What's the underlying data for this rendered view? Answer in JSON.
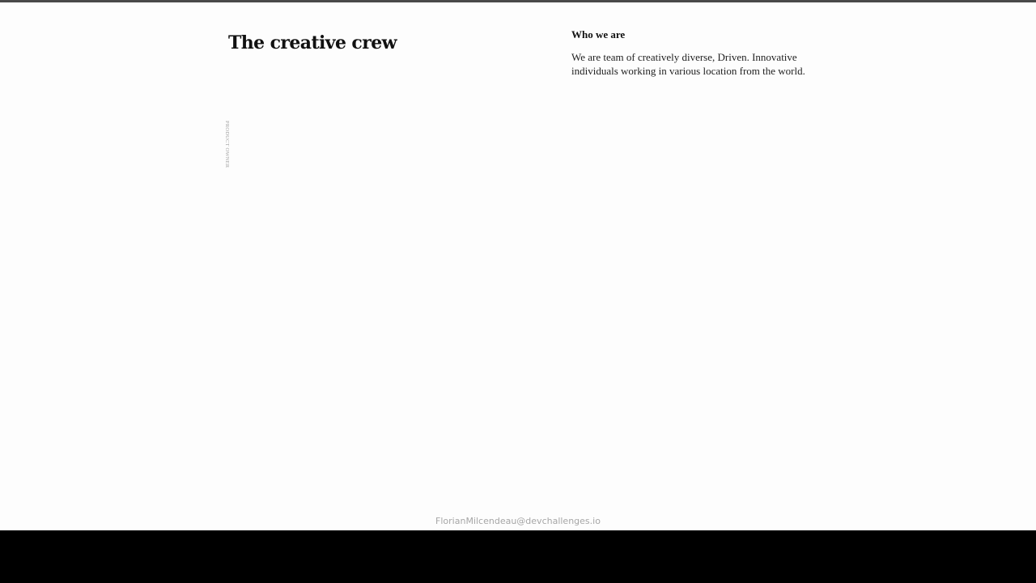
{
  "header": {
    "title": "The creative crew"
  },
  "about": {
    "heading": "Who we are",
    "text": "We are team of creatively diverse, Driven. Innovative individuals working in various location from the world."
  },
  "team": {
    "role_label": "PRODUCT OWNER"
  },
  "footer": {
    "credit": "FlorianMilcendeau@devchallenges.io"
  },
  "colors": {
    "background": "#fdfdfd",
    "text": "#111111",
    "muted": "#a6a6a6",
    "bottom_bar": "#000000"
  }
}
